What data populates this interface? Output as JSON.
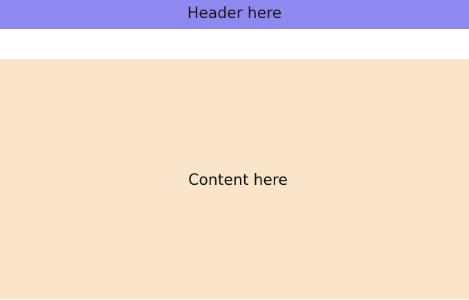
{
  "header": {
    "title": "Header here",
    "background": "#8f88f1"
  },
  "main": {
    "text": "Content here",
    "background": "#fbe5ca"
  }
}
